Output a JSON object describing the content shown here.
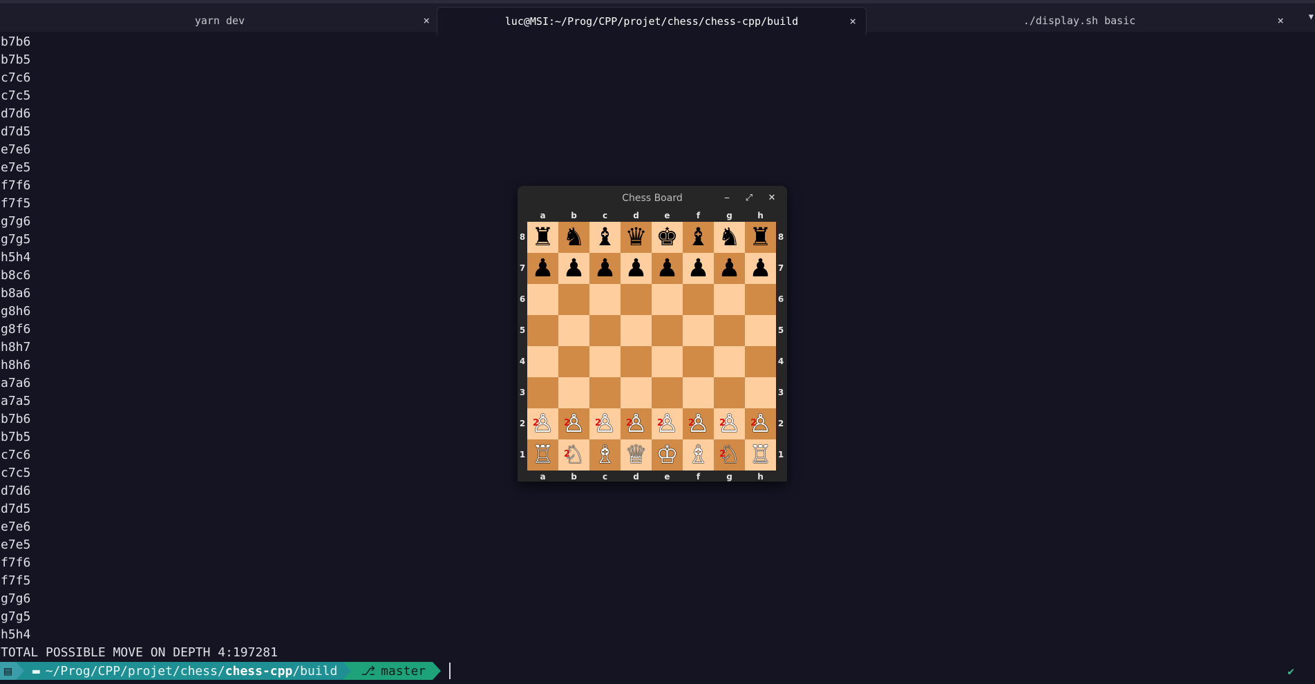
{
  "tabs": [
    {
      "label": "yarn dev",
      "close": "×"
    },
    {
      "label": "luc@MSI:~/Prog/CPP/projet/chess/chess-cpp/build",
      "close": "×"
    },
    {
      "label": "./display.sh basic",
      "close": "×"
    }
  ],
  "tab_overflow_icon": "chevron-down-icon",
  "output_lines": [
    "b7b6",
    "b7b5",
    "c7c6",
    "c7c5",
    "d7d6",
    "d7d5",
    "e7e6",
    "e7e5",
    "f7f6",
    "f7f5",
    "g7g6",
    "g7g5",
    "h5h4",
    "b8c6",
    "b8a6",
    "g8h6",
    "g8f6",
    "h8h7",
    "h8h6",
    "a7a6",
    "a7a5",
    "b7b6",
    "b7b5",
    "c7c6",
    "c7c5",
    "d7d6",
    "d7d5",
    "e7e6",
    "e7e5",
    "f7f6",
    "f7f5",
    "g7g6",
    "g7g5",
    "h5h4",
    "TOTAL POSSIBLE MOVE ON DEPTH 4:197281"
  ],
  "prompt": {
    "icon": "terminal-icon",
    "path_prefix": "~/Prog/CPP/projet/chess/",
    "path_bold": "chess-cpp",
    "path_suffix": "/build",
    "git_icon": "⎇",
    "branch": "master",
    "status": "✔"
  },
  "chess_window": {
    "title": "Chess Board",
    "minimize": "⎯",
    "maximize": "⤢",
    "close": "✕",
    "files": [
      "a",
      "b",
      "c",
      "d",
      "e",
      "f",
      "g",
      "h"
    ],
    "ranks": [
      "8",
      "7",
      "6",
      "5",
      "4",
      "3",
      "2",
      "1"
    ],
    "board": [
      [
        "♜",
        "♞",
        "♝",
        "♛",
        "♚",
        "♝",
        "♞",
        "♜"
      ],
      [
        "♟",
        "♟",
        "♟",
        "♟",
        "♟",
        "♟",
        "♟",
        "♟"
      ],
      [
        "",
        "",
        "",
        "",
        "",
        "",
        "",
        ""
      ],
      [
        "",
        "",
        "",
        "",
        "",
        "",
        "",
        ""
      ],
      [
        "",
        "",
        "",
        "",
        "",
        "",
        "",
        ""
      ],
      [
        "",
        "",
        "",
        "",
        "",
        "",
        "",
        ""
      ],
      [
        "♙",
        "♙",
        "♙",
        "♙",
        "♙",
        "♙",
        "♙",
        "♙"
      ],
      [
        "♖",
        "♘",
        "♗",
        "♕",
        "♔",
        "♗",
        "♘",
        "♖"
      ]
    ],
    "piece_colors": [
      "black",
      "black",
      "empty",
      "empty",
      "empty",
      "empty",
      "white",
      "white"
    ],
    "marks": [
      [
        "",
        "",
        "",
        "",
        "",
        "",
        "",
        ""
      ],
      [
        "",
        "",
        "",
        "",
        "",
        "",
        "",
        ""
      ],
      [
        "",
        "",
        "",
        "",
        "",
        "",
        "",
        ""
      ],
      [
        "",
        "",
        "",
        "",
        "",
        "",
        "",
        ""
      ],
      [
        "",
        "",
        "",
        "",
        "",
        "",
        "",
        ""
      ],
      [
        "",
        "",
        "",
        "",
        "",
        "",
        "",
        ""
      ],
      [
        "2",
        "2",
        "2",
        "2",
        "2",
        "2",
        "2",
        "2"
      ],
      [
        "",
        "2",
        "",
        "",
        "",
        "",
        "2",
        ""
      ]
    ],
    "colors": {
      "light": "#ffce9e",
      "dark": "#d18b47"
    }
  }
}
